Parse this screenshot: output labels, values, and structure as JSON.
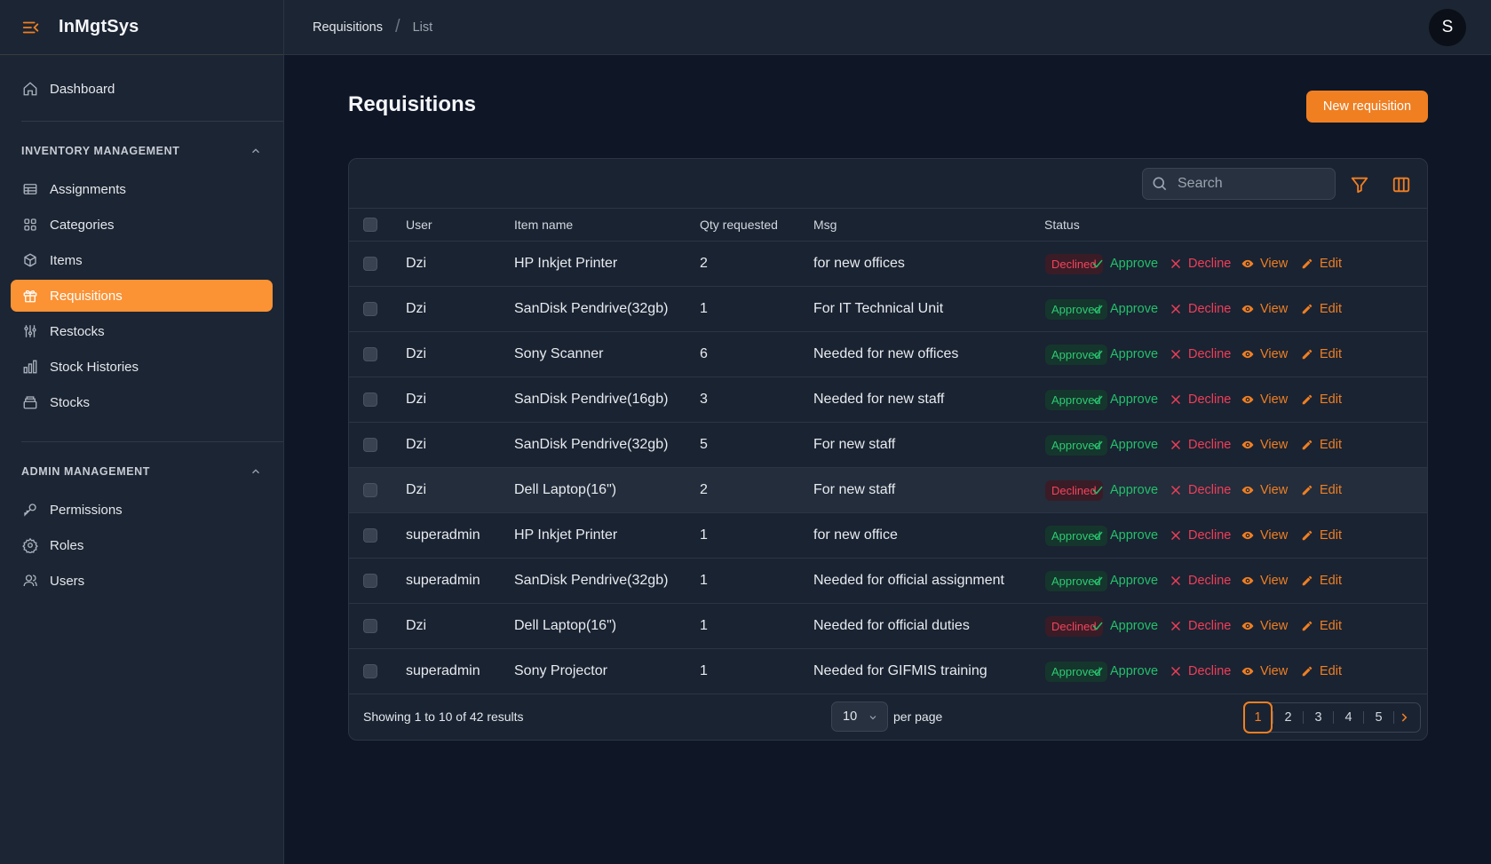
{
  "app": {
    "name": "InMgtSys"
  },
  "sidebar": {
    "dashboard": "Dashboard",
    "inventory_heading": "INVENTORY MANAGEMENT",
    "inventory_items": [
      {
        "label": "Assignments",
        "icon": "table-icon"
      },
      {
        "label": "Categories",
        "icon": "grid-icon"
      },
      {
        "label": "Items",
        "icon": "cube-icon"
      },
      {
        "label": "Requisitions",
        "icon": "gift-icon",
        "active": true
      },
      {
        "label": "Restocks",
        "icon": "adjustments-icon"
      },
      {
        "label": "Stock Histories",
        "icon": "bar-chart-icon"
      },
      {
        "label": "Stocks",
        "icon": "archive-icon"
      }
    ],
    "admin_heading": "ADMIN MANAGEMENT",
    "admin_items": [
      {
        "label": "Permissions",
        "icon": "key-icon"
      },
      {
        "label": "Roles",
        "icon": "cog-icon"
      },
      {
        "label": "Users",
        "icon": "users-icon"
      }
    ]
  },
  "topbar": {
    "breadcrumb": [
      "Requisitions",
      "List"
    ],
    "avatar": "S"
  },
  "page": {
    "title": "Requisitions",
    "new_button": "New requisition"
  },
  "table": {
    "search_placeholder": "Search",
    "columns": [
      "User",
      "Item name",
      "Qty requested",
      "Msg",
      "Status"
    ],
    "actions": [
      "Approve",
      "Decline",
      "View",
      "Edit"
    ],
    "rows": [
      {
        "user": "Dzi",
        "item": "HP Inkjet Printer",
        "qty": "2",
        "msg": "for new offices",
        "status": "Declined"
      },
      {
        "user": "Dzi",
        "item": "SanDisk Pendrive(32gb)",
        "qty": "1",
        "msg": "For IT Technical Unit",
        "status": "Approved"
      },
      {
        "user": "Dzi",
        "item": "Sony Scanner",
        "qty": "6",
        "msg": "Needed for new offices",
        "status": "Approved"
      },
      {
        "user": "Dzi",
        "item": "SanDisk Pendrive(16gb)",
        "qty": "3",
        "msg": "Needed for new staff",
        "status": "Approved"
      },
      {
        "user": "Dzi",
        "item": "SanDisk Pendrive(32gb)",
        "qty": "5",
        "msg": "For new staff",
        "status": "Approved"
      },
      {
        "user": "Dzi",
        "item": "Dell Laptop(16\")",
        "qty": "2",
        "msg": "For new staff",
        "status": "Declined"
      },
      {
        "user": "superadmin",
        "item": "HP Inkjet Printer",
        "qty": "1",
        "msg": "for new office",
        "status": "Approved"
      },
      {
        "user": "superadmin",
        "item": "SanDisk Pendrive(32gb)",
        "qty": "1",
        "msg": "Needed for official assignment",
        "status": "Approved"
      },
      {
        "user": "Dzi",
        "item": "Dell Laptop(16\")",
        "qty": "1",
        "msg": "Needed for official duties",
        "status": "Declined"
      },
      {
        "user": "superadmin",
        "item": "Sony Projector",
        "qty": "1",
        "msg": "Needed for GIFMIS training",
        "status": "Approved"
      }
    ]
  },
  "footer": {
    "summary": "Showing 1 to 10 of 42 results",
    "per_page_value": "10",
    "per_page_label": "per page",
    "pages": [
      "1",
      "2",
      "3",
      "4",
      "5"
    ],
    "current_page": "1"
  }
}
